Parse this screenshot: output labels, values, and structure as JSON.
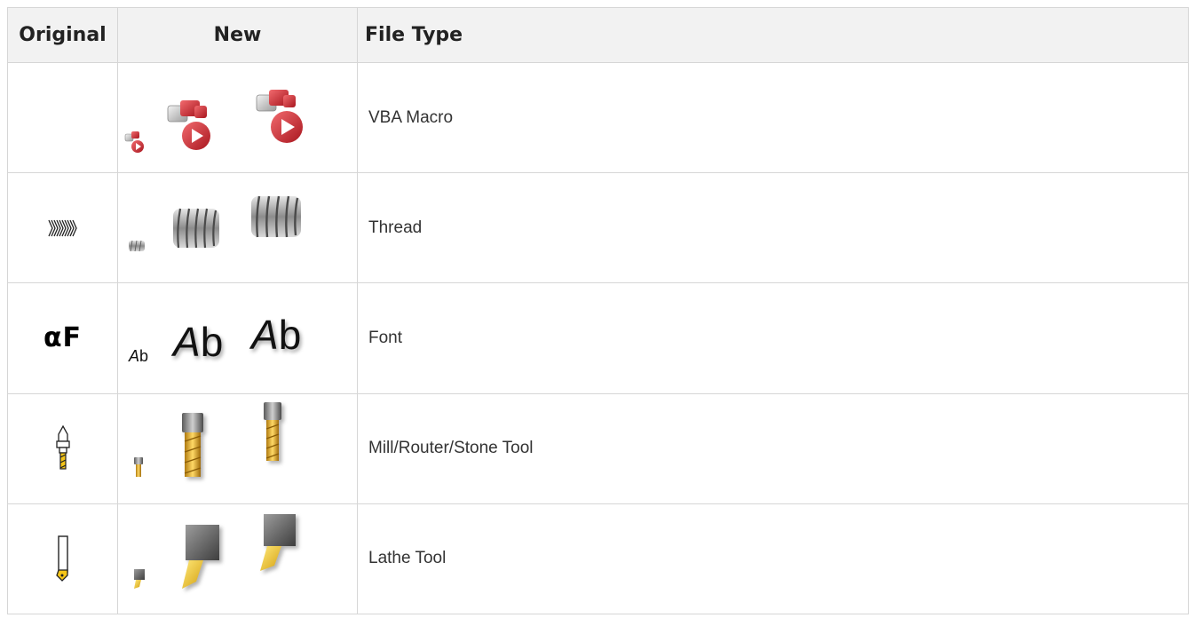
{
  "table": {
    "headers": {
      "original": "Original",
      "new": "New",
      "file_type": "File Type"
    },
    "rows": [
      {
        "file_type": "VBA Macro",
        "original_icon": "none",
        "new_icon": "vba-macro-icon"
      },
      {
        "file_type": "Thread",
        "original_icon": "thread-outline-icon",
        "new_icon": "thread-icon"
      },
      {
        "file_type": "Font",
        "original_icon": "alpha-f-font-icon",
        "new_icon": "font-ab-icon",
        "original_glyph": "αF",
        "new_glyph": "Ab"
      },
      {
        "file_type": "Mill/Router/Stone Tool",
        "original_icon": "mill-tool-outline-icon",
        "new_icon": "mill-tool-icon"
      },
      {
        "file_type": "Lathe Tool",
        "original_icon": "lathe-tool-outline-icon",
        "new_icon": "lathe-tool-icon"
      }
    ]
  },
  "colors": {
    "header_bg": "#f2f2f2",
    "border": "#d6d6d6",
    "macro_red": "#c8202a",
    "tool_gold": "#d9a520",
    "tool_gray": "#7a7a7a"
  }
}
